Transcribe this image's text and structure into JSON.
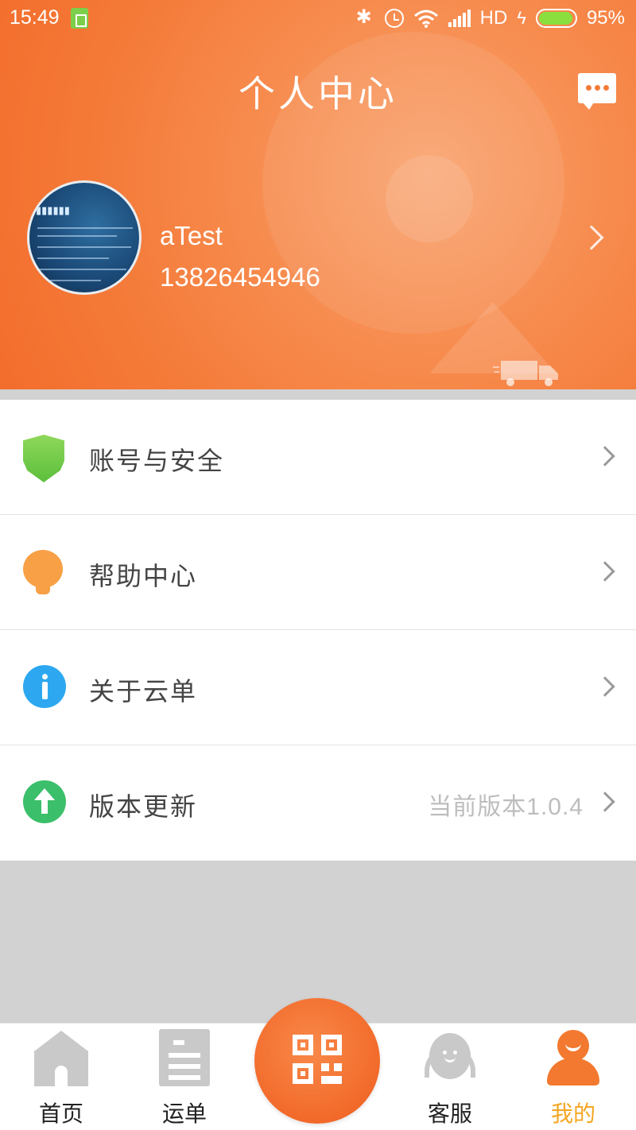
{
  "status_bar": {
    "time": "15:49",
    "network": "HD",
    "battery": "95%",
    "battery_level": 0.95
  },
  "header": {
    "title": "个人中心",
    "message_icon": "chat-bubble-icon"
  },
  "profile": {
    "name": "aTest",
    "phone": "13826454946",
    "avatar_icon": "avatar-photo"
  },
  "menu": {
    "items": [
      {
        "label": "账号与安全",
        "value": "",
        "icon": "shield-icon",
        "color": "#6cc94a"
      },
      {
        "label": "帮助中心",
        "value": "",
        "icon": "lightbulb-icon",
        "color": "#f7a046"
      },
      {
        "label": "关于云单",
        "value": "",
        "icon": "info-icon",
        "color": "#2da8f0"
      },
      {
        "label": "版本更新",
        "value": "当前版本1.0.4",
        "icon": "upgrade-icon",
        "color": "#3bbf6a"
      }
    ]
  },
  "bottom_nav": {
    "items": [
      {
        "label": "首页",
        "icon": "home-icon",
        "active": false
      },
      {
        "label": "运单",
        "icon": "waybill-icon",
        "active": false
      },
      {
        "label": "",
        "icon": "qr-scan-icon",
        "active": false
      },
      {
        "label": "客服",
        "icon": "customer-service-icon",
        "active": false
      },
      {
        "label": "我的",
        "icon": "me-icon",
        "active": true
      }
    ]
  },
  "colors": {
    "accent": "#f47a38",
    "active_tab": "#f5a623",
    "inactive_icon": "#c9c9c9"
  }
}
